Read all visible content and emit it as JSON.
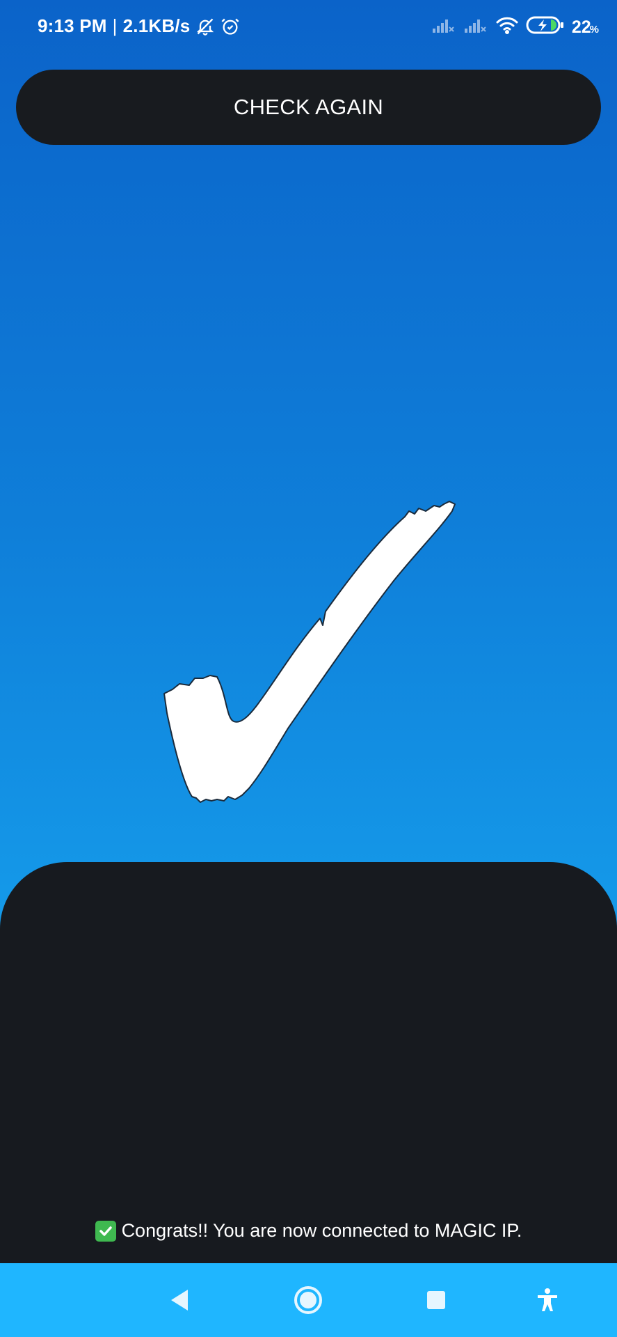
{
  "status_bar": {
    "time": "9:13 PM",
    "separator": "|",
    "net_speed": "2.1KB/s",
    "battery_percent": "22",
    "battery_unit": "%",
    "icons": [
      "bell-off-icon",
      "alarm-icon",
      "signal-icon",
      "signal-icon",
      "wifi-icon",
      "battery-charging-icon"
    ]
  },
  "actions": {
    "check_again_label": "CHECK AGAIN"
  },
  "main": {
    "status_icon": "checkmark-icon"
  },
  "message": {
    "emoji": "white-heavy-check-mark",
    "text": "Congrats!! You are now connected to MAGIC IP."
  },
  "nav_bar": {
    "items": [
      "back-icon",
      "home-icon",
      "recents-icon",
      "accessibility-icon"
    ]
  },
  "colors": {
    "gradient_top": "#0b63c9",
    "gradient_bottom": "#1aa8f2",
    "dark_panel": "#171a1f",
    "nav_bar": "#1fb6ff",
    "check_green": "#3fb950"
  }
}
